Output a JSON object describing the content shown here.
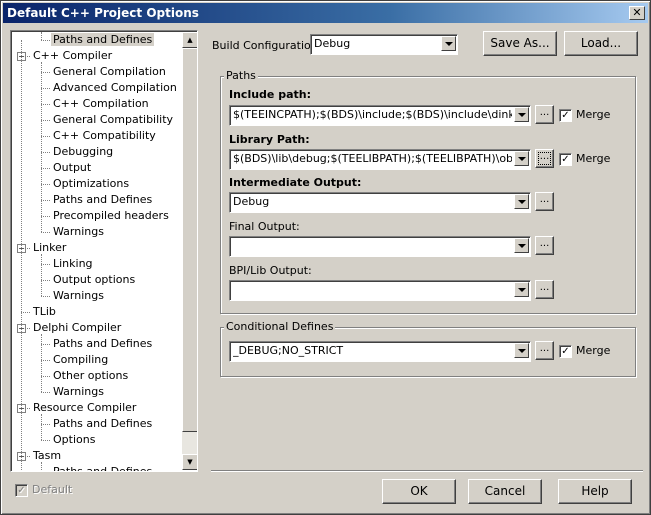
{
  "window": {
    "title": "Default C++ Project Options",
    "close_glyph": "✕"
  },
  "tree": {
    "items": [
      {
        "label": "Paths and Defines",
        "level": 1,
        "selected": true
      },
      {
        "label": "C++ Compiler",
        "level": 0,
        "expander": "−"
      },
      {
        "label": "General Compilation",
        "level": 1
      },
      {
        "label": "Advanced Compilation",
        "level": 1
      },
      {
        "label": "C++ Compilation",
        "level": 1
      },
      {
        "label": "General Compatibility",
        "level": 1
      },
      {
        "label": "C++ Compatibility",
        "level": 1
      },
      {
        "label": "Debugging",
        "level": 1
      },
      {
        "label": "Output",
        "level": 1
      },
      {
        "label": "Optimizations",
        "level": 1
      },
      {
        "label": "Paths and Defines",
        "level": 1
      },
      {
        "label": "Precompiled headers",
        "level": 1
      },
      {
        "label": "Warnings",
        "level": 1
      },
      {
        "label": "Linker",
        "level": 0,
        "expander": "−"
      },
      {
        "label": "Linking",
        "level": 1
      },
      {
        "label": "Output options",
        "level": 1
      },
      {
        "label": "Warnings",
        "level": 1
      },
      {
        "label": "TLib",
        "level": 0
      },
      {
        "label": "Delphi Compiler",
        "level": 0,
        "expander": "−"
      },
      {
        "label": "Paths and Defines",
        "level": 1
      },
      {
        "label": "Compiling",
        "level": 1
      },
      {
        "label": "Other options",
        "level": 1
      },
      {
        "label": "Warnings",
        "level": 1
      },
      {
        "label": "Resource Compiler",
        "level": 0,
        "expander": "−"
      },
      {
        "label": "Paths and Defines",
        "level": 1
      },
      {
        "label": "Options",
        "level": 1
      },
      {
        "label": "Tasm",
        "level": 0,
        "expander": "−"
      },
      {
        "label": "Paths and Defines",
        "level": 1
      }
    ],
    "scroll_up": "▲",
    "scroll_down": "▼"
  },
  "build_config": {
    "label": "Build Configuration:",
    "value": "Debug"
  },
  "buttons": {
    "save_as": "Save As...",
    "load": "Load...",
    "ok": "OK",
    "cancel": "Cancel",
    "help": "Help",
    "ellipsis": "..."
  },
  "paths": {
    "group_title": "Paths",
    "include": {
      "label": "Include path:",
      "value": "$(TEEINCPATH);$(BDS)\\include;$(BDS)\\include\\dinkumware",
      "merge_label": "Merge",
      "merge_checked": true
    },
    "library": {
      "label": "Library Path:",
      "value": "$(BDS)\\lib\\debug;$(TEELIBPATH);$(TEELIBPATH)\\obj;$(BDS",
      "merge_label": "Merge",
      "merge_checked": true
    },
    "intermediate": {
      "label": "Intermediate Output:",
      "value": "Debug"
    },
    "final": {
      "label": "Final Output:",
      "value": ""
    },
    "bpi": {
      "label": "BPI/Lib Output:",
      "value": ""
    }
  },
  "conditional": {
    "group_title": "Conditional Defines",
    "value": "_DEBUG;NO_STRICT",
    "merge_label": "Merge",
    "merge_checked": true
  },
  "default_checkbox": {
    "label": "Default",
    "checked": true
  },
  "check_glyph": "✓"
}
